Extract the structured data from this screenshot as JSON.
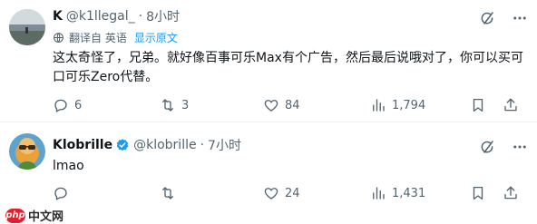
{
  "tweets": [
    {
      "display_name": "K",
      "handle": "@k1llegal_",
      "separator": "·",
      "time": "8小时",
      "translated_label": "翻译自 英语",
      "show_original": "显示原文",
      "text": "这太奇怪了，兄弟。就好像百事可乐Max有个广告，然后最后说哦对了，你可以买可口可乐Zero代替。",
      "stats": {
        "replies": "6",
        "retweets": "3",
        "likes": "84",
        "views": "1,794"
      }
    },
    {
      "display_name": "Klobrille",
      "handle": "@klobrille",
      "separator": "·",
      "time": "7小时",
      "text": "lmao",
      "stats": {
        "replies": "",
        "retweets": "",
        "likes": "24",
        "views": "1,431"
      }
    }
  ],
  "icons": {
    "grok": "grok-icon",
    "more": "more-icon",
    "translate": "translate-icon",
    "reply": "reply-icon",
    "retweet": "retweet-icon",
    "like": "heart-icon",
    "views": "views-icon",
    "bookmark": "bookmark-icon",
    "share": "share-icon"
  },
  "colors": {
    "text": "#0f1419",
    "secondary": "#536471",
    "link": "#1d9bf0",
    "divider": "#eff3f4",
    "verified_badge": "#1d9bf0"
  },
  "watermark": {
    "logo": "php",
    "text": "中文网"
  }
}
